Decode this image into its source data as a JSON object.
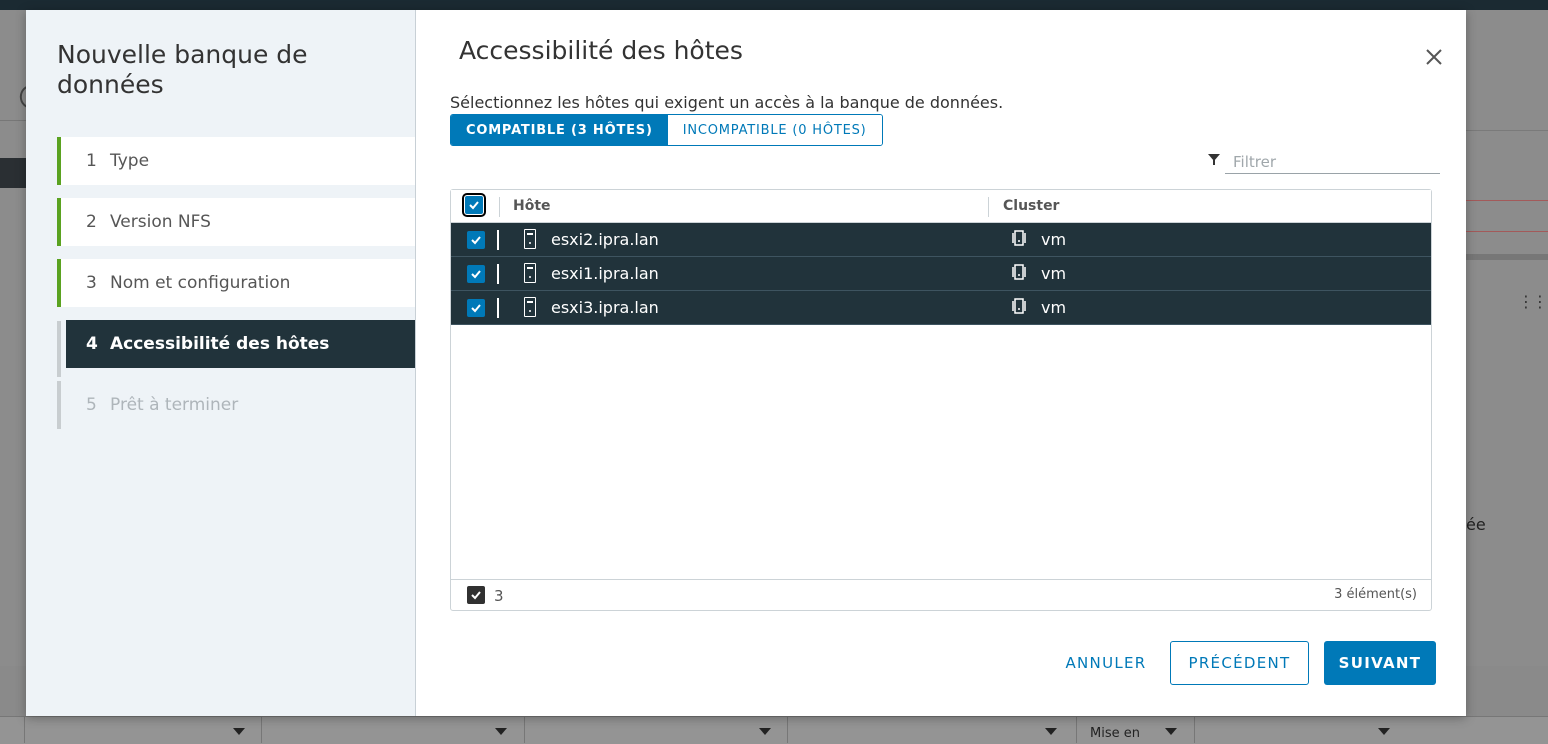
{
  "background": {
    "partial_text": "ée",
    "column_label": "Mise en"
  },
  "wizard": {
    "title": "Nouvelle banque de données",
    "steps": [
      {
        "num": "1",
        "label": "Type"
      },
      {
        "num": "2",
        "label": "Version NFS"
      },
      {
        "num": "3",
        "label": "Nom et configuration"
      },
      {
        "num": "4",
        "label": "Accessibilité des hôtes"
      },
      {
        "num": "5",
        "label": "Prêt à terminer"
      }
    ]
  },
  "page": {
    "title": "Accessibilité des hôtes",
    "subtitle": "Sélectionnez les hôtes qui exigent un accès à la banque de données.",
    "tabs": {
      "compatible": "COMPATIBLE (3 HÔTES)",
      "incompatible": "INCOMPATIBLE (0 HÔTES)"
    },
    "filter_placeholder": "Filtrer"
  },
  "grid": {
    "columns": {
      "host": "Hôte",
      "cluster": "Cluster"
    },
    "rows": [
      {
        "host": "esxi2.ipra.lan",
        "cluster": "vm"
      },
      {
        "host": "esxi1.ipra.lan",
        "cluster": "vm"
      },
      {
        "host": "esxi3.ipra.lan",
        "cluster": "vm"
      }
    ],
    "selected_count": "3",
    "total": "3 élément(s)"
  },
  "buttons": {
    "cancel": "ANNULER",
    "previous": "PRÉCÉDENT",
    "next": "SUIVANT"
  },
  "colors": {
    "accent": "#0079b8",
    "selected_row": "#21333b",
    "step_done": "#5aa220"
  }
}
